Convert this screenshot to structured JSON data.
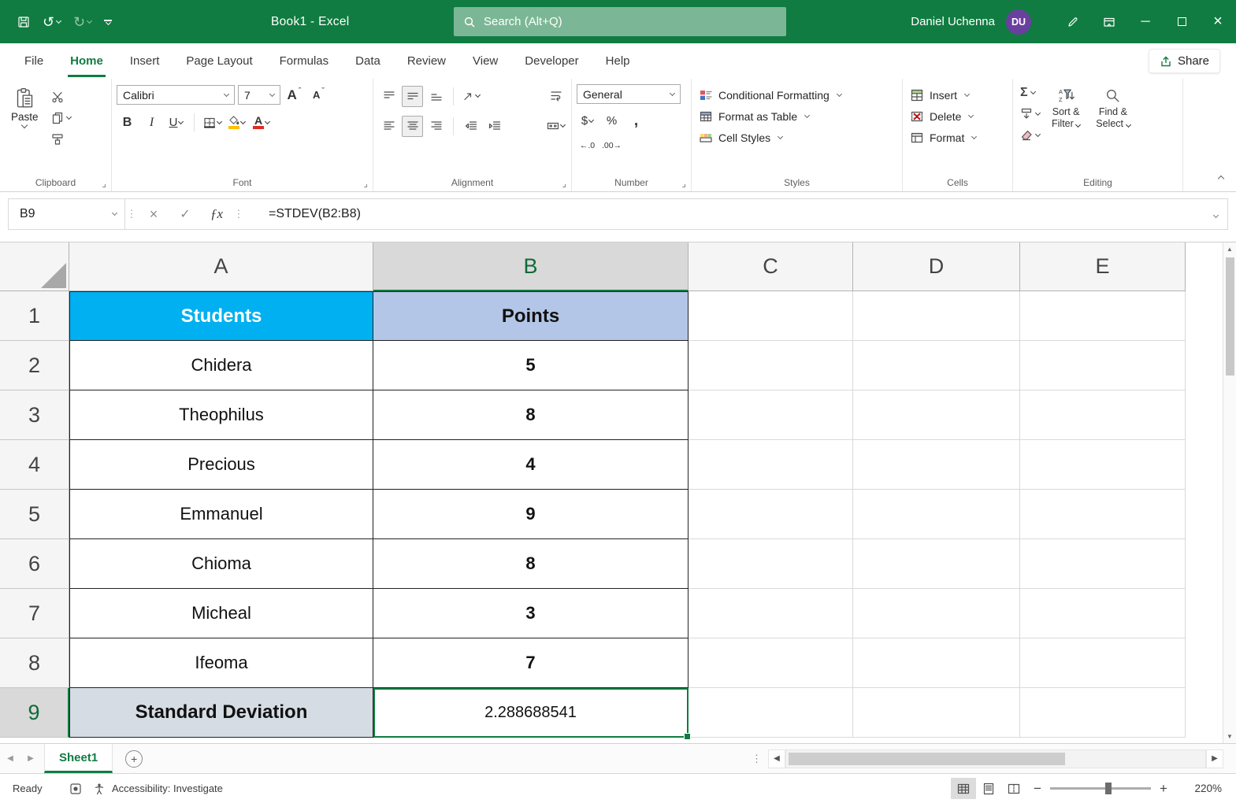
{
  "titlebar": {
    "title": "Book1 - Excel",
    "search_placeholder": "Search (Alt+Q)",
    "user_name": "Daniel Uchenna",
    "user_initials": "DU"
  },
  "tabs": {
    "items": [
      "File",
      "Home",
      "Insert",
      "Page Layout",
      "Formulas",
      "Data",
      "Review",
      "View",
      "Developer",
      "Help"
    ],
    "active": "Home",
    "share_label": "Share"
  },
  "ribbon": {
    "groups": [
      "Clipboard",
      "Font",
      "Alignment",
      "Number",
      "Styles",
      "Cells",
      "Editing"
    ],
    "paste_label": "Paste",
    "font_name": "Calibri",
    "font_size": "7",
    "bold": "B",
    "italic": "I",
    "underline": "U",
    "number_format": "General",
    "currency": "$",
    "percent": "%",
    "comma": ",",
    "increase_decimal": "←.0",
    "decrease_decimal": ".00→",
    "conditional_formatting": "Conditional Formatting",
    "format_as_table": "Format as Table",
    "cell_styles": "Cell Styles",
    "insert_label": "Insert",
    "delete_label": "Delete",
    "format_label": "Format",
    "autosum": "Σ",
    "sort_filter_line1": "Sort &",
    "sort_filter_line2": "Filter",
    "find_select_line1": "Find &",
    "find_select_line2": "Select"
  },
  "formula_bar": {
    "name_box": "B9",
    "fx": "ƒx",
    "formula": "=STDEV(B2:B8)"
  },
  "sheet": {
    "columns": [
      "A",
      "B",
      "C",
      "D",
      "E"
    ],
    "selected_column": "B",
    "selected_row": "9",
    "rows": [
      {
        "n": "1",
        "a": "Students",
        "b": "Points"
      },
      {
        "n": "2",
        "a": "Chidera",
        "b": "5"
      },
      {
        "n": "3",
        "a": "Theophilus",
        "b": "8"
      },
      {
        "n": "4",
        "a": "Precious",
        "b": "4"
      },
      {
        "n": "5",
        "a": "Emmanuel",
        "b": "9"
      },
      {
        "n": "6",
        "a": "Chioma",
        "b": "8"
      },
      {
        "n": "7",
        "a": "Micheal",
        "b": "3"
      },
      {
        "n": "8",
        "a": "Ifeoma",
        "b": "7"
      },
      {
        "n": "9",
        "a": "Standard Deviation",
        "b": "2.288688541"
      }
    ]
  },
  "sheetbar": {
    "sheet_name": "Sheet1"
  },
  "statusbar": {
    "ready": "Ready",
    "accessibility": "Accessibility: Investigate",
    "zoom": "220%"
  },
  "colors": {
    "excel_green": "#107C41",
    "students_header_fill": "#00B0F0",
    "points_header_fill": "#B4C6E7",
    "std_dev_label_fill": "#D6DCE4",
    "avatar_purple": "#6B3FA0"
  }
}
